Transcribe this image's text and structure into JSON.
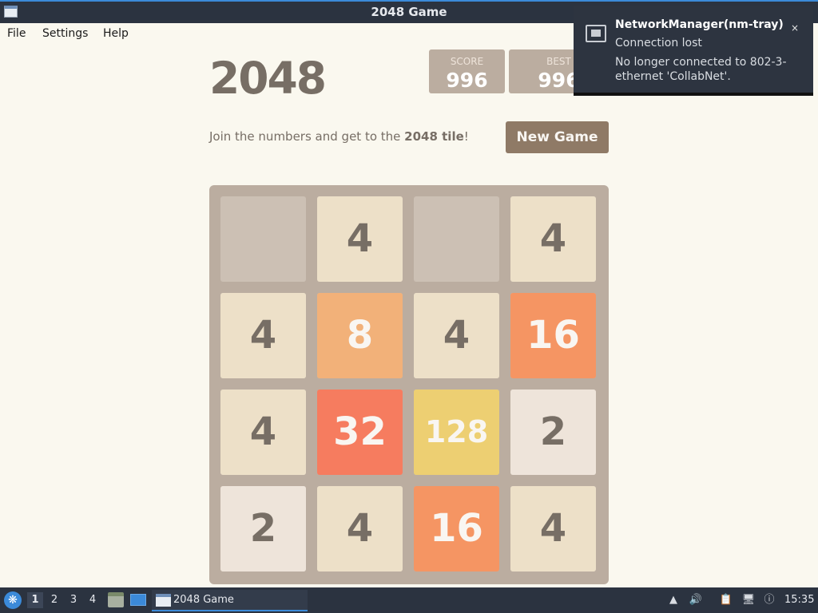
{
  "window": {
    "title": "2048 Game"
  },
  "menu": {
    "items": [
      "File",
      "Settings",
      "Help"
    ]
  },
  "game": {
    "title": "2048",
    "score_label": "SCORE",
    "score": "996",
    "best_label": "BEST",
    "best": "996",
    "intro_prefix": "Join the numbers and get to the ",
    "intro_bold": "2048 tile",
    "intro_suffix": "!",
    "new_game": "New Game",
    "board": [
      [
        0,
        4,
        0,
        4
      ],
      [
        4,
        8,
        4,
        16
      ],
      [
        4,
        32,
        128,
        2
      ],
      [
        2,
        4,
        16,
        4
      ]
    ]
  },
  "notification": {
    "app": "NetworkManager(nm-tray)",
    "summary": "Connection lost",
    "body": "No longer connected to 802-3-ethernet 'CollabNet'.",
    "close": "×",
    "icon": "network-wired-icon"
  },
  "taskbar": {
    "desktops": [
      "1",
      "2",
      "3",
      "4"
    ],
    "active_desktop": "1",
    "task_label": "2048 Game",
    "clock": "15:35"
  },
  "colors": {
    "accent": "#3b8ad9",
    "board": "#bbada0",
    "tile_2": "#eee4da",
    "tile_4": "#ede0c8",
    "tile_8": "#f2b179",
    "tile_16": "#f59563",
    "tile_32": "#f67c5f",
    "tile_128": "#edcf72"
  }
}
